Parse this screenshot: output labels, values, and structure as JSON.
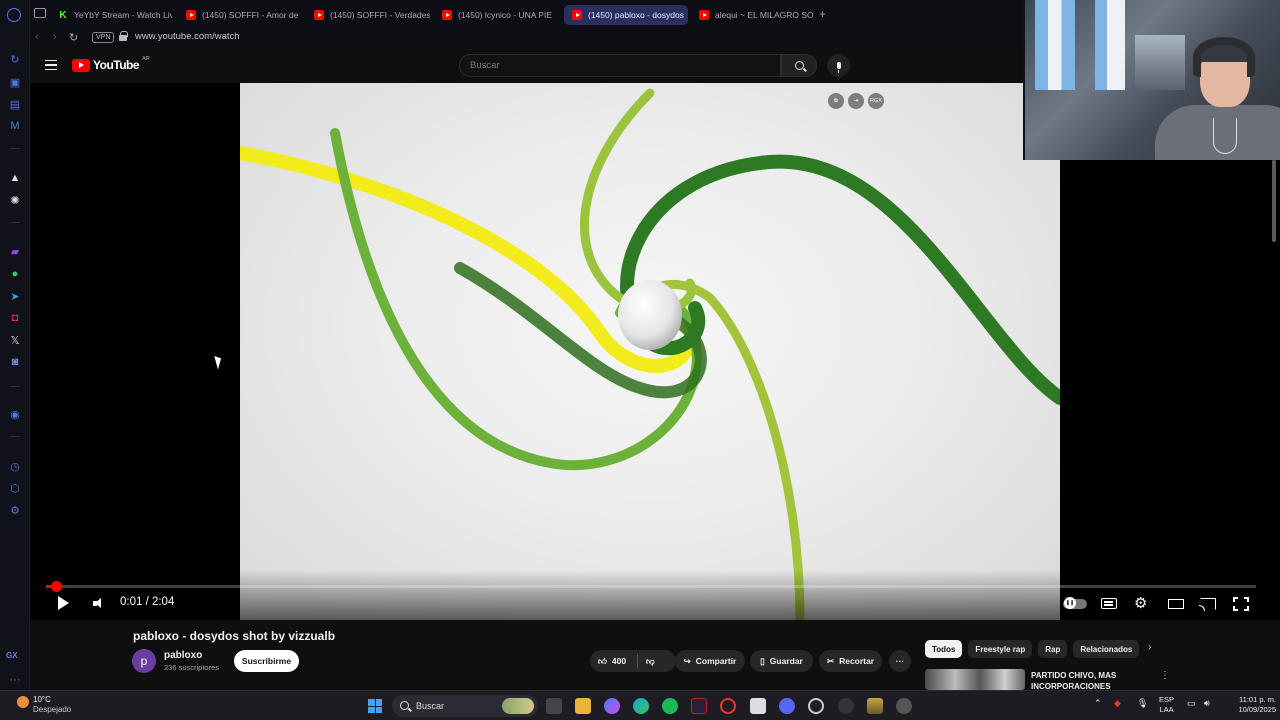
{
  "browser": {
    "tabs": [
      {
        "title": "YeYbY Stream - Watch Liv",
        "favicon": "kick-icon",
        "active": false
      },
      {
        "title": "(1450) SOFFFI - Amor de",
        "favicon": "youtube-icon",
        "active": false
      },
      {
        "title": "(1450) SOFFFI - Verdades",
        "favicon": "youtube-icon",
        "active": false
      },
      {
        "title": "(1450) lcynico - UNA PIE",
        "favicon": "youtube-icon",
        "active": false
      },
      {
        "title": "(1450) pabloxo - dosydos",
        "favicon": "youtube-icon",
        "active": true
      },
      {
        "title": "alequi ~ EL MILAGRO SO",
        "favicon": "youtube-icon",
        "active": false
      }
    ],
    "new_tab": "+",
    "vpn_label": "VPN",
    "url": "www.youtube.com/watch",
    "sidebar_label": "GX"
  },
  "youtube": {
    "logo_text": "YouTube",
    "region": "AR",
    "search_placeholder": "Buscar",
    "player": {
      "current_time": "0:01",
      "duration": "2:04",
      "time_display": "0:01 / 2:04",
      "progress_fraction": 0.008,
      "extension_icons": [
        "copy-icon",
        "login-icon",
        "RGX"
      ]
    },
    "video": {
      "title": "pabloxo - dosydos shot by vizzualb",
      "channel_initial": "p",
      "channel": "pabloxo",
      "subscribers": "236 suscriptores",
      "subscribe_label": "Suscribirme",
      "likes": "400",
      "share_label": "Compartir",
      "save_label": "Guardar",
      "clip_label": "Recortar",
      "more_label": "···"
    },
    "chips": [
      "Todos",
      "Freestyle rap",
      "Rap",
      "Relacionados"
    ],
    "recommendation": {
      "title": "PARTIDO CHIVO, MAS INCORPORACIONES"
    }
  },
  "taskbar": {
    "weather_temp": "10°C",
    "weather_cond": "Despejado",
    "search_label": "Buscar",
    "lang_top": "ESP",
    "lang_bottom": "LAA",
    "time": "11:01 p. m.",
    "date": "10/09/2025"
  },
  "colors": {
    "accent": "#ff0000",
    "tab_active": "#2b2f5e",
    "opera_blue": "#4b78e6"
  }
}
